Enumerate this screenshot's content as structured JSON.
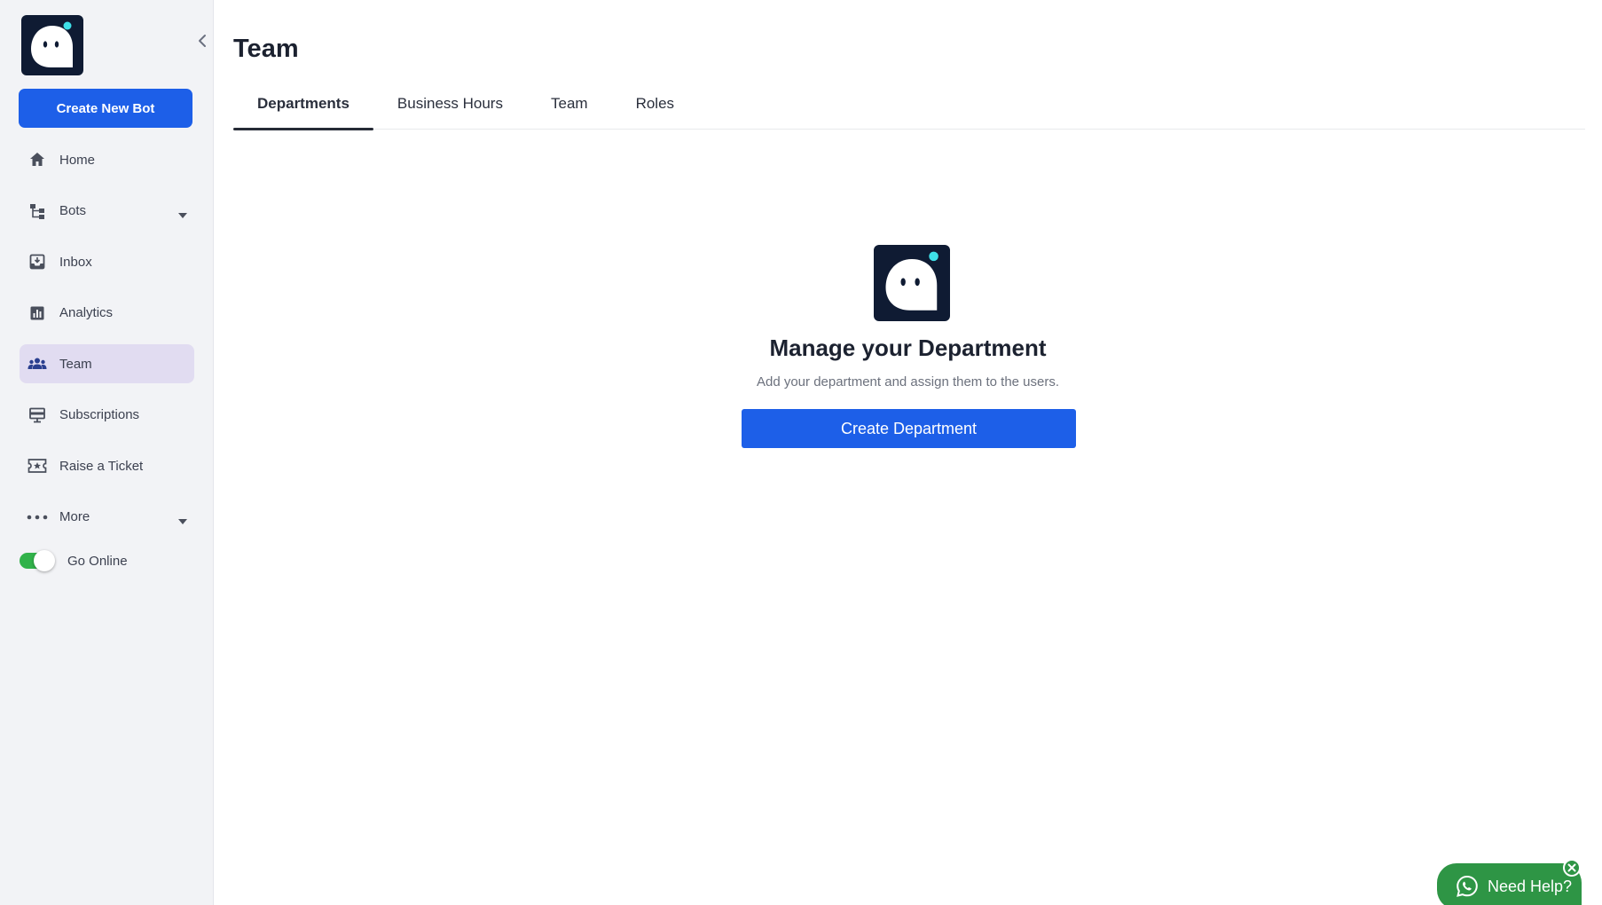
{
  "app": {
    "brand_color": "#1d5fe8",
    "logo_icon": "ghost-mascot-icon"
  },
  "sidebar": {
    "create_button": "Create New Bot",
    "items": [
      {
        "label": "Home",
        "icon": "home-icon",
        "active": false
      },
      {
        "label": "Bots",
        "icon": "flow-icon",
        "active": false,
        "has_submenu": true
      },
      {
        "label": "Inbox",
        "icon": "inbox-icon",
        "active": false
      },
      {
        "label": "Analytics",
        "icon": "analytics-icon",
        "active": false
      },
      {
        "label": "Team",
        "icon": "team-icon",
        "active": true
      },
      {
        "label": "Subscriptions",
        "icon": "subscriptions-icon",
        "active": false
      },
      {
        "label": "Raise a Ticket",
        "icon": "ticket-icon",
        "active": false
      },
      {
        "label": "More",
        "icon": "more-icon",
        "active": false,
        "has_submenu": true
      }
    ],
    "online_toggle": {
      "label": "Go Online",
      "on": true,
      "color": "#31b24a"
    }
  },
  "main": {
    "title": "Team",
    "tabs": [
      {
        "label": "Departments",
        "active": true
      },
      {
        "label": "Business Hours",
        "active": false
      },
      {
        "label": "Team",
        "active": false
      },
      {
        "label": "Roles",
        "active": false
      }
    ],
    "empty_state": {
      "title": "Manage your Department",
      "subtitle": "Add your department and assign them to the users.",
      "button": "Create Department"
    }
  },
  "help_widget": {
    "label": "Need Help?",
    "color": "#2e9545",
    "icon": "whatsapp-icon"
  }
}
